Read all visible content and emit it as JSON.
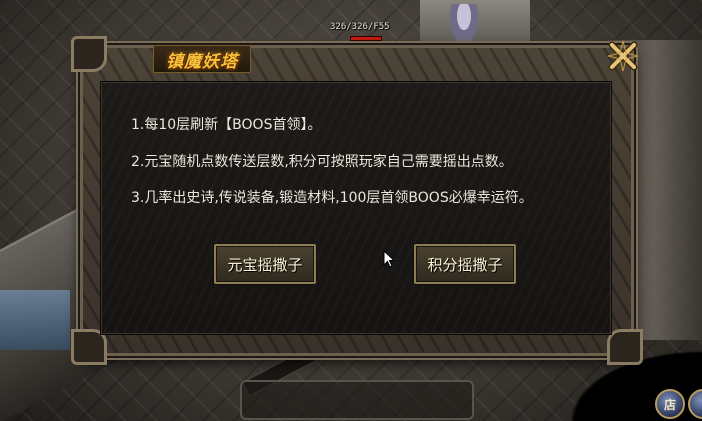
{
  "hud": {
    "player_stats": "326/326/F55"
  },
  "dialog": {
    "title": "镇魔妖塔",
    "lines": [
      "1.每10层刷新【BOOS首领】。",
      "2.元宝随机点数传送层数,积分可按照玩家自己需要摇出点数。",
      "3.几率出史诗,传说装备,锻造材料,100层首领BOOS必爆幸运符。"
    ],
    "buttons": {
      "yuanbao_roll": "元宝摇撒子",
      "points_roll": "积分摇撒子"
    }
  },
  "toolbar": {
    "shop_label": "店"
  },
  "colors": {
    "title": "#f6c23a",
    "text": "#ece7dc",
    "hp_bar": "#c21c12"
  }
}
